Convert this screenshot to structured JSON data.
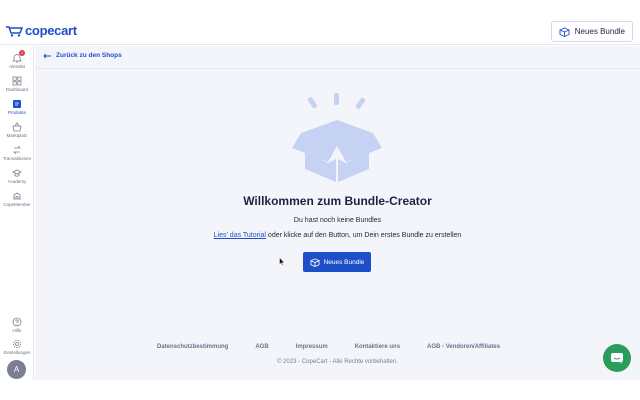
{
  "brand": {
    "name": "copecart",
    "color": "#1f4fc8"
  },
  "topbar": {
    "new_bundle_label": "Neues Bundle"
  },
  "sidebar": {
    "items": [
      {
        "label": "Aktivität",
        "icon": "bell-icon",
        "badge": "1"
      },
      {
        "label": "Dashboard",
        "icon": "grid-icon"
      },
      {
        "label": "Produkte",
        "icon": "product-icon",
        "active": true
      },
      {
        "label": "Marktplatz",
        "icon": "basket-icon"
      },
      {
        "label": "Transaktionen",
        "icon": "transactions-icon"
      },
      {
        "label": "Academy",
        "icon": "academy-icon"
      },
      {
        "label": "CopeMember",
        "icon": "members-icon"
      }
    ],
    "bottom_items": [
      {
        "label": "Hilfe",
        "icon": "help-icon"
      },
      {
        "label": "Einstellungen",
        "icon": "gear-icon"
      }
    ],
    "avatar_initial": "A"
  },
  "main": {
    "back_label": "Zurück zu den Shops",
    "title": "Willkommen zum Bundle-Creator",
    "subtitle": "Du hast noch keine Bundles",
    "tutorial_link": "Lies' das Tutorial",
    "description_rest": " oder klicke auf den Button, um Dein erstes Bundle zu erstellen",
    "new_bundle_label": "Neues Bundle"
  },
  "footer": {
    "links": [
      "Datenschutzbestimmung",
      "AGB",
      "Impressum",
      "Kontaktiere uns",
      "AGB - Vendoren/Affiliates"
    ],
    "copyright": "© 2023 - CopeCart - Alle Rechte vorbehalten."
  },
  "chat": {
    "icon": "chat-icon",
    "color": "#2a9d5a"
  }
}
